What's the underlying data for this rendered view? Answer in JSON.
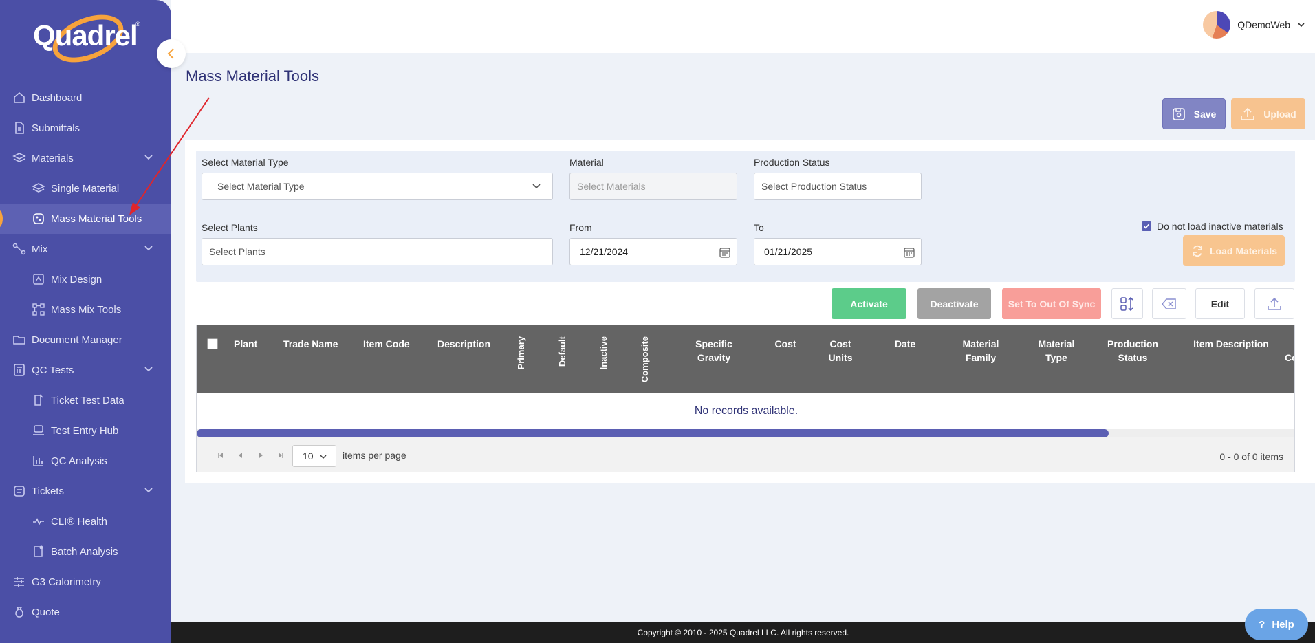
{
  "sidebar": {
    "logo_text": "Quadrel",
    "logo_reg": "®",
    "items": [
      {
        "label": "Dashboard"
      },
      {
        "label": "Submittals"
      },
      {
        "label": "Materials"
      },
      {
        "label": "Single Material"
      },
      {
        "label": "Mass Material Tools"
      },
      {
        "label": "Mix"
      },
      {
        "label": "Mix Design"
      },
      {
        "label": "Mass Mix Tools"
      },
      {
        "label": "Document Manager"
      },
      {
        "label": "QC Tests"
      },
      {
        "label": "Ticket Test Data"
      },
      {
        "label": "Test Entry Hub"
      },
      {
        "label": "QC Analysis"
      },
      {
        "label": "Tickets"
      },
      {
        "label": "CLI® Health"
      },
      {
        "label": "Batch Analysis"
      },
      {
        "label": "G3 Calorimetry"
      },
      {
        "label": "Quote"
      }
    ]
  },
  "header": {
    "user_name": "QDemoWeb"
  },
  "page": {
    "title": "Mass Material Tools"
  },
  "toolbar": {
    "save_label": "Save",
    "upload_label": "Upload"
  },
  "filters": {
    "material_type_label": "Select Material Type",
    "material_type_placeholder": "Select Material Type",
    "material_label": "Material",
    "material_placeholder": "Select Materials",
    "production_status_label": "Production Status",
    "production_status_placeholder": "Select Production Status",
    "plants_label": "Select Plants",
    "plants_placeholder": "Select Plants",
    "from_label": "From",
    "from_value": "12/21/2024",
    "to_label": "To",
    "to_value": "01/21/2025",
    "inactive_checkbox_label": "Do not load inactive materials",
    "inactive_checked": true,
    "load_label": "Load Materials"
  },
  "actions": {
    "activate": "Activate",
    "deactivate": "Deactivate",
    "out_of_sync": "Set To Out Of Sync",
    "edit": "Edit"
  },
  "table": {
    "columns": {
      "plant": "Plant",
      "trade_name": "Trade Name",
      "item_code": "Item Code",
      "description": "Description",
      "primary": "Primary",
      "default": "Default",
      "inactive": "Inactive",
      "composite": "Composite",
      "specific_gravity_1": "Specific",
      "specific_gravity_2": "Gravity",
      "cost": "Cost",
      "cost_units_1": "Cost",
      "cost_units_2": "Units",
      "date": "Date",
      "material_family_1": "Material",
      "material_family_2": "Family",
      "material_type_1": "Material",
      "material_type_2": "Type",
      "production_status_1": "Production",
      "production_status_2": "Status",
      "item_description": "Item Description",
      "next_partial": "Co"
    },
    "empty_message": "No records available.",
    "scroll_position": 0.83,
    "page_size": "10",
    "items_per_page_label": "items per page",
    "page_info": "0 - 0 of 0 items"
  },
  "footer": {
    "copyright": "Copyright © 2010 - 2025 Quadrel LLC. All rights reserved."
  },
  "help": {
    "label": "Help"
  },
  "colors": {
    "sidebar": "#4b4fa6",
    "accent_orange": "#f7a33c",
    "activate": "#5ccc8a",
    "header_grid": "#646464"
  }
}
